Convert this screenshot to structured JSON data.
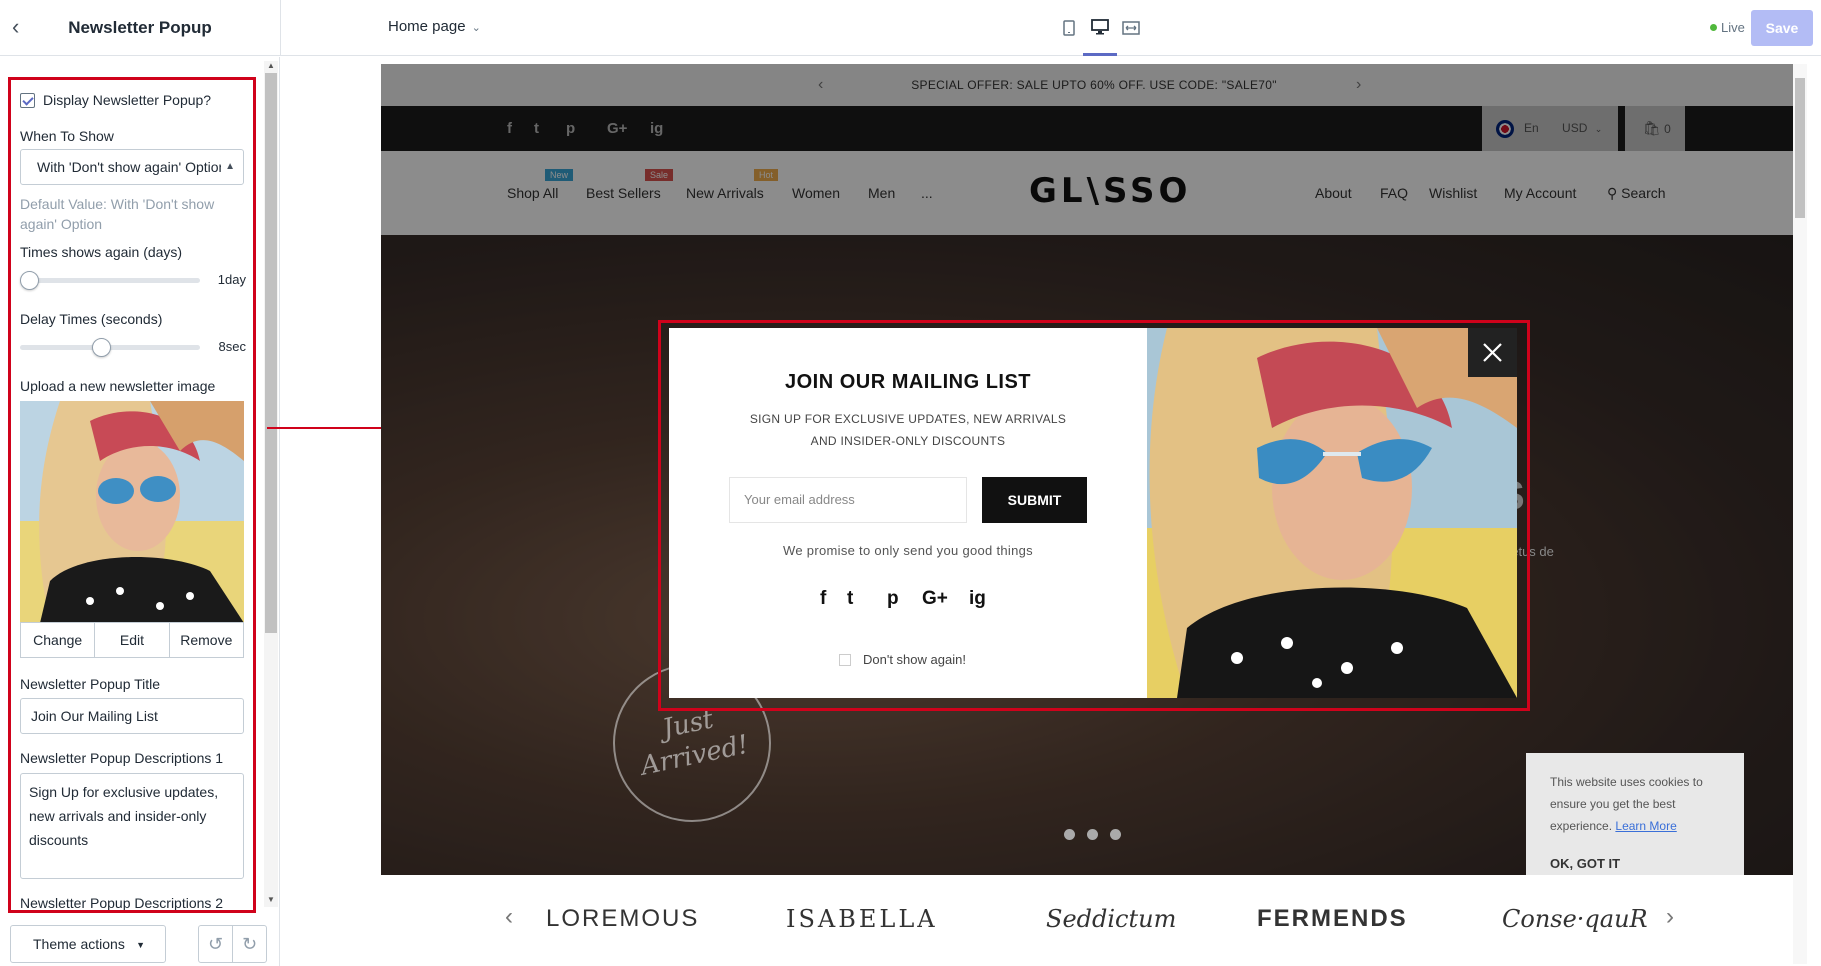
{
  "topbar": {
    "back_icon": "chevron-left-icon",
    "section_title": "Newsletter Popup",
    "page_selector": "Home page",
    "devices": [
      "mobile-icon",
      "desktop-icon",
      "fullwidth-icon"
    ],
    "status": "Live",
    "save_label": "Save"
  },
  "settings": {
    "display_label": "Display Newsletter Popup?",
    "display_checked": true,
    "when_to_show_label": "When To Show",
    "when_to_show_value": "With 'Don't show again' Option",
    "when_to_show_help": "Default Value: With 'Don't show again' Option",
    "times_label": "Times shows again (days)",
    "times_value": "1day",
    "times_level": 0,
    "delay_label": "Delay Times (seconds)",
    "delay_value": "8sec",
    "delay_level": 0.45,
    "upload_label": "Upload a new newsletter image",
    "image_buttons": [
      "Change",
      "Edit",
      "Remove"
    ],
    "popup_title_label": "Newsletter Popup Title",
    "popup_title_value": "Join Our Mailing List",
    "desc1_label": "Newsletter Popup Descriptions 1",
    "desc1_value": "Sign Up for exclusive updates, new arrivals and insider-only discounts",
    "desc2_label": "Newsletter Popup Descriptions 2"
  },
  "footer": {
    "theme_actions": "Theme actions",
    "undo_icon": "undo-icon",
    "redo_icon": "redo-icon"
  },
  "store": {
    "announcement": "SPECIAL OFFER: SALE UPTO 60% OFF. USE CODE: \"SALE70\"",
    "social_icons": [
      "f",
      "t",
      "p",
      "G+",
      "ig"
    ],
    "language": "En",
    "currency": "USD",
    "cart_count": "0",
    "logo": "GL\\SSO",
    "nav_left": [
      {
        "label": "Shop All",
        "badge": "New"
      },
      {
        "label": "Best Sellers",
        "badge": "Sale"
      },
      {
        "label": "New Arrivals",
        "badge": "Hot"
      },
      {
        "label": "Women",
        "badge": ""
      },
      {
        "label": "Men",
        "badge": ""
      },
      {
        "label": "...",
        "badge": ""
      }
    ],
    "nav_right": [
      "About",
      "FAQ",
      "Wishlist",
      "My Account",
      "Search"
    ],
    "hero_stamp": "Just Arrived!",
    "hero_partial_title": "S",
    "hero_partial_text": "netus de",
    "cookie": {
      "text": "This website uses cookies to ensure you get the best experience.",
      "link": "Learn More",
      "button": "OK, GOT IT"
    },
    "brands": [
      "LOREMOUS",
      "ISABELLA",
      "Seddictum",
      "FERMENDS",
      "Conse·qauR"
    ]
  },
  "popup": {
    "title": "JOIN OUR MAILING LIST",
    "description": "SIGN UP FOR EXCLUSIVE UPDATES, NEW ARRIVALS AND INSIDER-ONLY DISCOUNTS",
    "email_placeholder": "Your email address",
    "submit": "SUBMIT",
    "promise": "We promise to only send you good things",
    "social": [
      "f",
      "t",
      "p",
      "G+",
      "ig"
    ],
    "dont_show": "Don't show again!"
  },
  "colors": {
    "highlight": "#d0021b",
    "accent": "#5c6ac4",
    "save_disabled": "#b3bcf5",
    "live_dot": "#50b83c"
  }
}
